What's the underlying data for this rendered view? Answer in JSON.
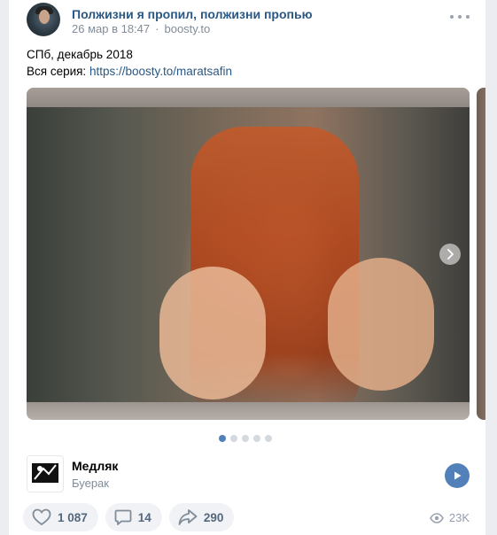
{
  "post": {
    "author": "Полжизни я пропил, полжизни пропью",
    "date": "26 мар в 18:47",
    "source": "boosty.to",
    "text_line1": "СПб, декабрь 2018",
    "series_label": "Вся серия: ",
    "series_link": "https://boosty.to/maratsafin"
  },
  "carousel": {
    "total_slides": 5,
    "active_slide": 1
  },
  "audio": {
    "title": "Медляк",
    "artist": "Буерак"
  },
  "actions": {
    "likes": "1 087",
    "comments": "14",
    "shares": "290",
    "views": "23K"
  },
  "icons": [
    "more-icon",
    "next-arrow-icon",
    "play-icon",
    "heart-icon",
    "comment-icon",
    "share-icon",
    "eye-icon"
  ],
  "colors": {
    "link": "#2a5885",
    "accent": "#5181b8",
    "muted": "#818c99"
  }
}
